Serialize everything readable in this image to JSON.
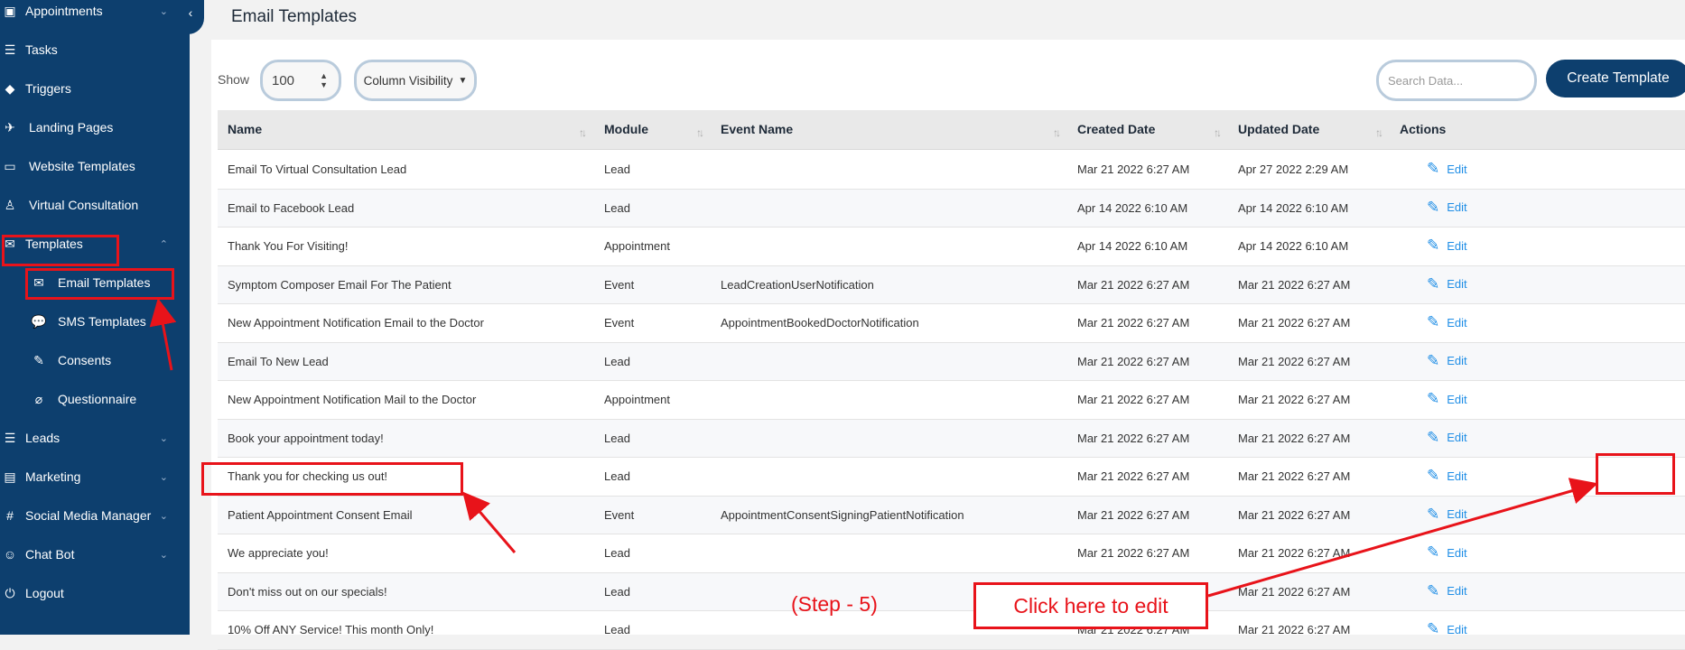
{
  "sidebar": {
    "collapse_icon": "‹",
    "items": [
      {
        "label": "Appointments",
        "icon": "calendar-check-icon",
        "glyph": "▣",
        "has_chevron": true
      },
      {
        "label": "Tasks",
        "icon": "list-icon",
        "glyph": "☰",
        "has_chevron": false
      },
      {
        "label": "Triggers",
        "icon": "diamond-icon",
        "glyph": "◆",
        "has_chevron": false
      },
      {
        "label": "Landing Pages",
        "icon": "plane-landing-icon",
        "glyph": "✈",
        "has_chevron": false
      },
      {
        "label": "Website Templates",
        "icon": "laptop-icon",
        "glyph": "▭",
        "has_chevron": false
      },
      {
        "label": "Virtual Consultation",
        "icon": "person-desk-icon",
        "glyph": "♙",
        "has_chevron": false
      },
      {
        "label": "Templates",
        "icon": "envelope-open-icon",
        "glyph": "✉",
        "has_chevron": true
      },
      {
        "label": "Email Templates",
        "icon": "envelope-icon",
        "glyph": "✉",
        "has_chevron": false
      },
      {
        "label": "SMS Templates",
        "icon": "chat-icon",
        "glyph": "💬",
        "has_chevron": false
      },
      {
        "label": "Consents",
        "icon": "signature-icon",
        "glyph": "✎",
        "has_chevron": false
      },
      {
        "label": "Questionnaire",
        "icon": "paperclip-icon",
        "glyph": "⌀",
        "has_chevron": false
      },
      {
        "label": "Leads",
        "icon": "list-ordered-icon",
        "glyph": "☰",
        "has_chevron": true
      },
      {
        "label": "Marketing",
        "icon": "book-icon",
        "glyph": "▤",
        "has_chevron": true
      },
      {
        "label": "Social Media Manager",
        "icon": "hashtag-icon",
        "glyph": "#",
        "has_chevron": true
      },
      {
        "label": "Chat Bot",
        "icon": "robot-icon",
        "glyph": "☺",
        "has_chevron": true
      },
      {
        "label": "Logout",
        "icon": "power-icon",
        "glyph": "⏻",
        "has_chevron": false
      }
    ]
  },
  "header": {
    "title": "Email Templates"
  },
  "controls": {
    "show_label": "Show",
    "show_value": "100",
    "column_visibility": "Column Visibility",
    "search_placeholder": "Search Data...",
    "create_button": "Create Template"
  },
  "table": {
    "columns": [
      "Name",
      "Module",
      "Event Name",
      "Created Date",
      "Updated Date",
      "Actions"
    ],
    "action_label": "Edit",
    "rows": [
      [
        "Email To Virtual Consultation Lead",
        "Lead",
        "",
        "Mar 21 2022 6:27 AM",
        "Apr 27 2022 2:29 AM"
      ],
      [
        "Email to Facebook Lead",
        "Lead",
        "",
        "Apr 14 2022 6:10 AM",
        "Apr 14 2022 6:10 AM"
      ],
      [
        "Thank You For Visiting!",
        "Appointment",
        "",
        "Apr 14 2022 6:10 AM",
        "Apr 14 2022 6:10 AM"
      ],
      [
        "Symptom Composer Email For The Patient",
        "Event",
        "LeadCreationUserNotification",
        "Mar 21 2022 6:27 AM",
        "Mar 21 2022 6:27 AM"
      ],
      [
        "New Appointment Notification Email to the Doctor",
        "Event",
        "AppointmentBookedDoctorNotification",
        "Mar 21 2022 6:27 AM",
        "Mar 21 2022 6:27 AM"
      ],
      [
        "Email To New Lead",
        "Lead",
        "",
        "Mar 21 2022 6:27 AM",
        "Mar 21 2022 6:27 AM"
      ],
      [
        "New Appointment Notification Mail to the Doctor",
        "Appointment",
        "",
        "Mar 21 2022 6:27 AM",
        "Mar 21 2022 6:27 AM"
      ],
      [
        "Book your appointment today!",
        "Lead",
        "",
        "Mar 21 2022 6:27 AM",
        "Mar 21 2022 6:27 AM"
      ],
      [
        "Thank you for checking us out!",
        "Lead",
        "",
        "Mar 21 2022 6:27 AM",
        "Mar 21 2022 6:27 AM"
      ],
      [
        "Patient Appointment Consent Email",
        "Event",
        "AppointmentConsentSigningPatientNotification",
        "Mar 21 2022 6:27 AM",
        "Mar 21 2022 6:27 AM"
      ],
      [
        "We appreciate you!",
        "Lead",
        "",
        "Mar 21 2022 6:27 AM",
        "Mar 21 2022 6:27 AM"
      ],
      [
        "Don't miss out on our specials!",
        "Lead",
        "",
        "Mar 21 2022 6:27 AM",
        "Mar 21 2022 6:27 AM"
      ],
      [
        "10% Off ANY Service! This month Only!",
        "Lead",
        "",
        "Mar 21 2022 6:27 AM",
        "Mar 21 2022 6:27 AM"
      ]
    ]
  },
  "annotations": {
    "step": "(Step - 5)",
    "callout": "Click here to edit",
    "color": "#e8131a"
  },
  "colors": {
    "sidebar": "#0d3f6e",
    "accent": "#1f8ee6",
    "annotation": "#e8131a"
  }
}
